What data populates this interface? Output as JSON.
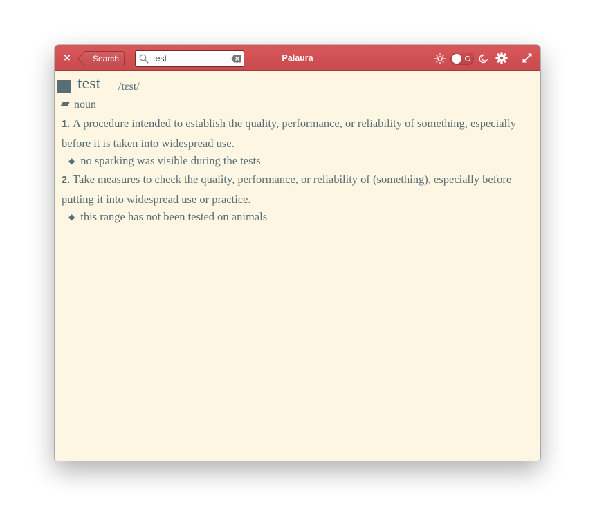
{
  "header": {
    "close_label": "×",
    "back_label": "Search",
    "search_value": "test",
    "title": "Palaura",
    "icons": [
      "close-icon",
      "search-icon",
      "clear-icon",
      "sun-icon",
      "moon-icon",
      "gear-icon",
      "expand-icon"
    ],
    "dark_mode_toggle": false
  },
  "entry": {
    "word": "test",
    "phonetic": "/tɛst/",
    "part_of_speech": "noun",
    "definitions": [
      {
        "number": "1.",
        "text": "A procedure intended to establish the quality, performance, or reliability of something, especially before it is taken into widespread use.",
        "example": "no sparking was visible during the tests"
      },
      {
        "number": "2.",
        "text": "Take measures to check the quality, performance, or reliability of (something), especially before putting it into widespread use or practice.",
        "example": "this range has not been tested on animals"
      }
    ],
    "bullet": "◆"
  },
  "colors": {
    "headerbar": "#d9585b",
    "content_bg": "#fdf6e3",
    "text": "#586e75"
  }
}
